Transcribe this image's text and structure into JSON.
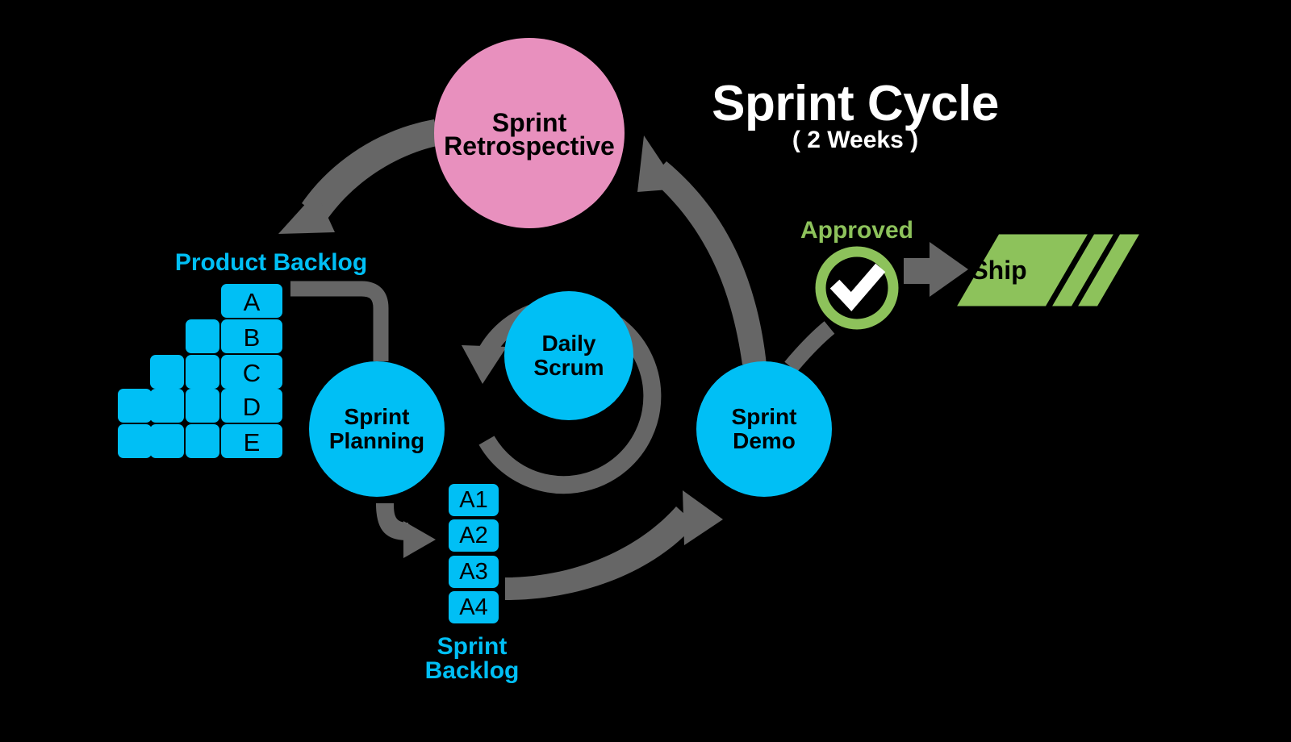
{
  "diagram": {
    "title": "Sprint Cycle",
    "subtitle": "( 2 Weeks )",
    "background_color": "#000000",
    "colors": {
      "cyan": "#00BFF5",
      "pink": "#E890BE",
      "green": "#8DC25B",
      "arrow_gray": "#666666",
      "white": "#FFFFFF",
      "black": "#000000"
    }
  },
  "product_backlog": {
    "label": "Product Backlog",
    "label_color": "#00BFF5",
    "items": [
      {
        "label": "A",
        "stack_count": 0
      },
      {
        "label": "B",
        "stack_count": 1
      },
      {
        "label": "C",
        "stack_count": 2
      },
      {
        "label": "D",
        "stack_count": 3
      },
      {
        "label": "E",
        "stack_count": 3
      }
    ]
  },
  "sprint_backlog": {
    "label": "Sprint\nBacklog",
    "label_line1": "Sprint",
    "label_line2": "Backlog",
    "label_color": "#00BFF5",
    "items": [
      {
        "label": "A1"
      },
      {
        "label": "A2"
      },
      {
        "label": "A3"
      },
      {
        "label": "A4"
      }
    ]
  },
  "nodes": [
    {
      "id": "sprint-retrospective",
      "label": "Sprint\nRetrospective",
      "line1": "Sprint",
      "line2": "Retrospective",
      "color": "#E890BE",
      "shape": "circle"
    },
    {
      "id": "sprint-planning",
      "label": "Sprint\nPlanning",
      "line1": "Sprint",
      "line2": "Planning",
      "color": "#00BFF5",
      "shape": "circle"
    },
    {
      "id": "daily-scrum",
      "label": "Daily\nScrum",
      "line1": "Daily",
      "line2": "Scrum",
      "color": "#00BFF5",
      "shape": "circle"
    },
    {
      "id": "sprint-demo",
      "label": "Sprint\nDemo",
      "line1": "Sprint",
      "line2": "Demo",
      "color": "#00BFF5",
      "shape": "circle"
    }
  ],
  "approval": {
    "label": "Approved",
    "label_color": "#8DC25B",
    "icon": "check-circle-icon",
    "ring_color": "#8DC25B",
    "check_color": "#FFFFFF"
  },
  "ship": {
    "label": "Ship",
    "color": "#8DC25B",
    "stack_count": 3
  },
  "flow_arrows": [
    {
      "from": "sprint-retrospective",
      "to": "product-backlog",
      "style": "curved"
    },
    {
      "from": "product-backlog-A",
      "to": "sprint-planning",
      "style": "elbow"
    },
    {
      "from": "sprint-planning",
      "to": "sprint-backlog",
      "style": "curved"
    },
    {
      "from": "sprint-backlog-A4",
      "to": "sprint-demo",
      "style": "curved"
    },
    {
      "from": "sprint-demo",
      "to": "sprint-retrospective",
      "style": "curved"
    },
    {
      "from": "daily-scrum",
      "to": "daily-scrum",
      "style": "loop"
    },
    {
      "from": "sprint-demo",
      "to": "approved",
      "style": "short"
    },
    {
      "from": "approved",
      "to": "ship",
      "style": "straight"
    }
  ]
}
